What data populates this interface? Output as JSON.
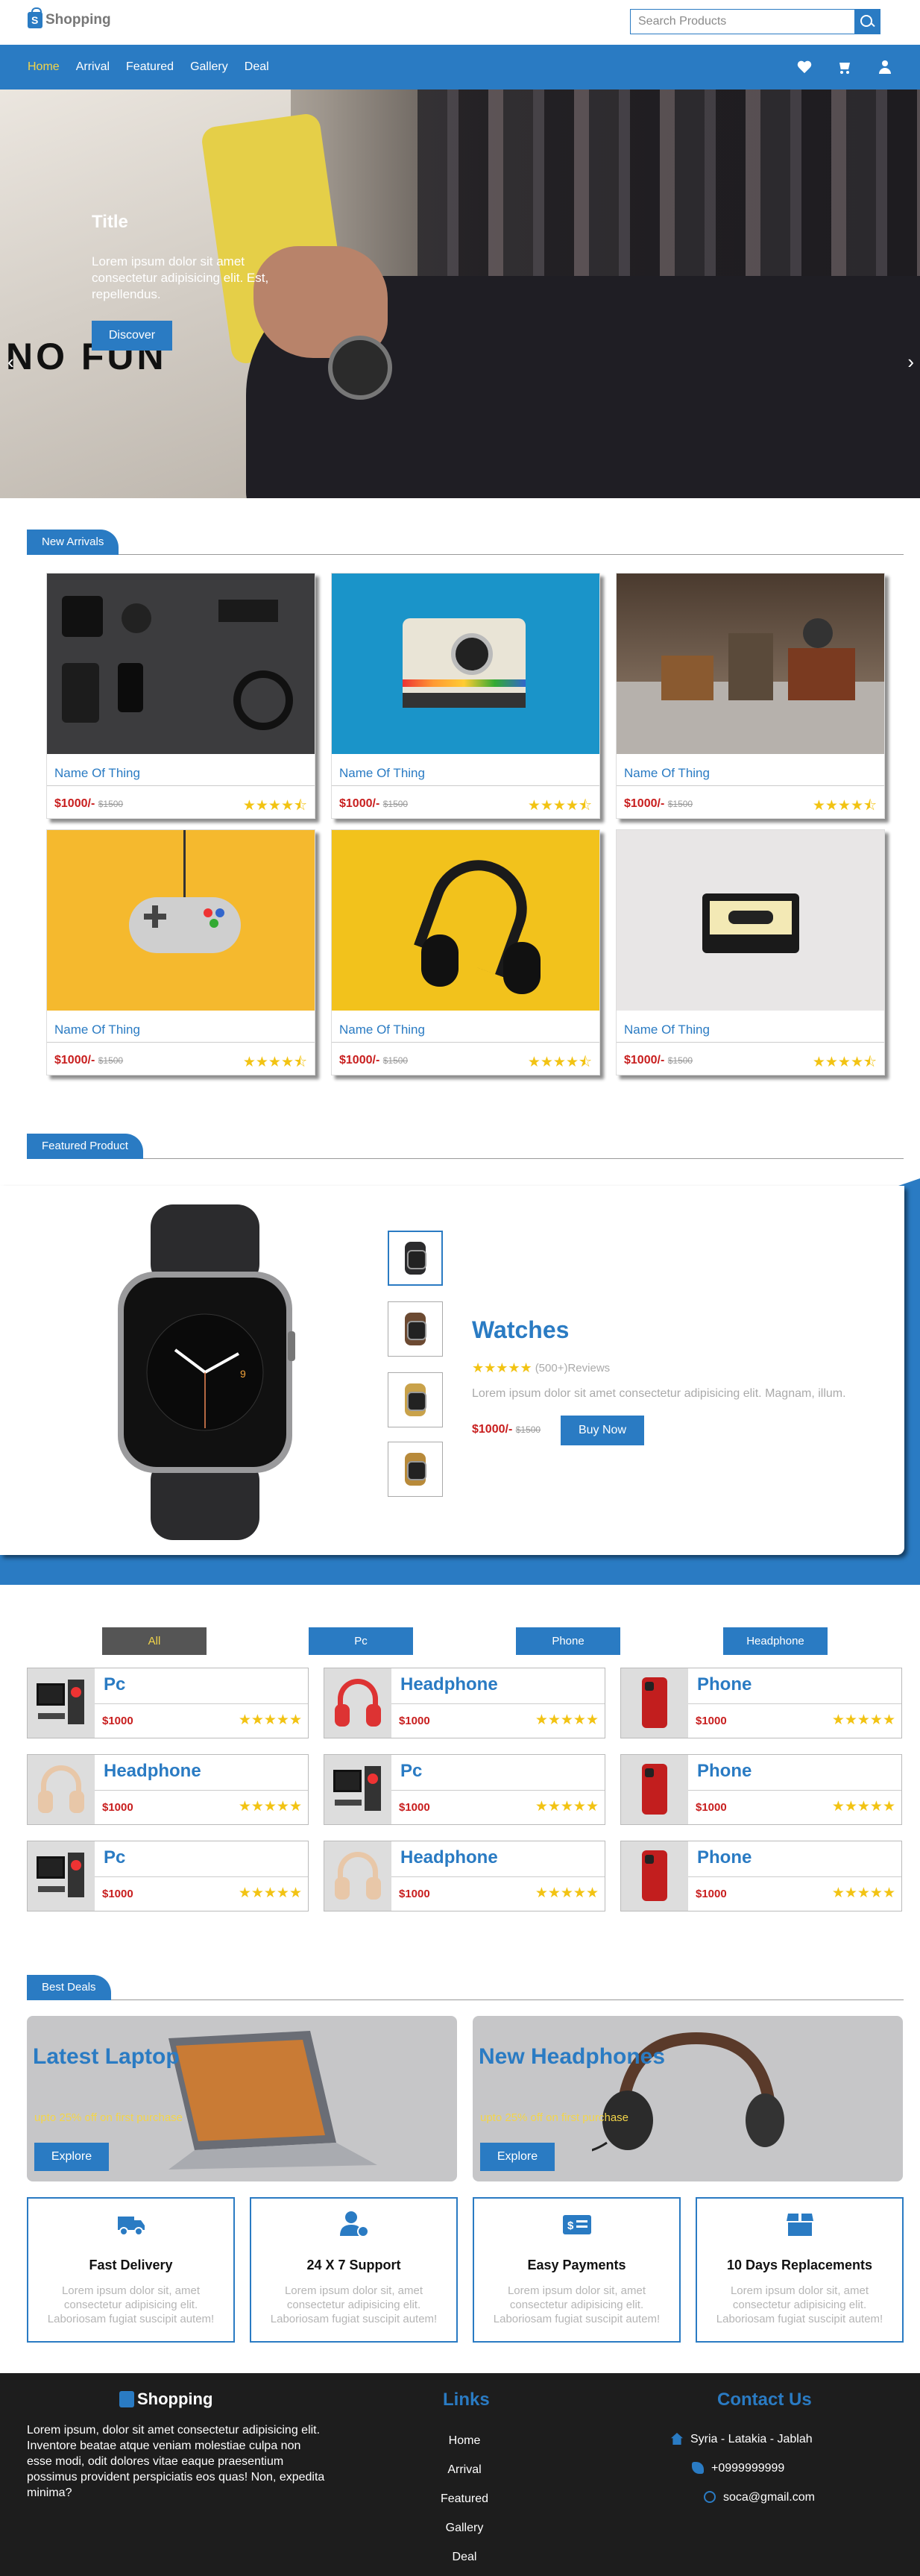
{
  "brand": "Shopping",
  "search": {
    "placeholder": "Search Products"
  },
  "nav": {
    "links": [
      "Home",
      "Arrival",
      "Featured",
      "Gallery",
      "Deal"
    ],
    "active": "Home",
    "icons": [
      "heart-icon",
      "cart-icon",
      "user-icon"
    ]
  },
  "hero": {
    "title": "Title",
    "text": "Lorem ipsum dolor sit amet consectetur adipisicing elit. Est, repellendus.",
    "button": "Discover",
    "photo_text": "NO FUN",
    "prev": "‹",
    "next": "›"
  },
  "new_arrivals": {
    "heading": "New Arrivals",
    "products": [
      {
        "name": "Name Of Thing",
        "price": "$1000/-",
        "old_price": "$1500",
        "rating": 4.5,
        "image": "flat-lay-accessories"
      },
      {
        "name": "Name Of Thing",
        "price": "$1000/-",
        "old_price": "$1500",
        "rating": 4.5,
        "image": "polaroid-camera"
      },
      {
        "name": "Name Of Thing",
        "price": "$1000/-",
        "old_price": "$1500",
        "rating": 4.5,
        "image": "vintage-cameras"
      },
      {
        "name": "Name Of Thing",
        "price": "$1000/-",
        "old_price": "$1500",
        "rating": 4.5,
        "image": "game-controller"
      },
      {
        "name": "Name Of Thing",
        "price": "$1000/-",
        "old_price": "$1500",
        "rating": 4.5,
        "image": "headphones"
      },
      {
        "name": "Name Of Thing",
        "price": "$1000/-",
        "old_price": "$1500",
        "rating": 4.5,
        "image": "cassette-tape"
      }
    ]
  },
  "featured": {
    "heading": "Featured Product",
    "title": "Watches",
    "reviews": "(500+)Reviews",
    "rating": 5,
    "description": "Lorem ipsum dolor sit amet consectetur adipisicing elit. Magnam, illum.",
    "price": "$1000/-",
    "old_price": "$1500",
    "button": "Buy Now",
    "thumbnails": [
      "black-watch",
      "brown-watch",
      "gold-watch",
      "gold-watch-2"
    ],
    "selected_thumbnail": 0
  },
  "categories": {
    "filters": [
      "All",
      "Pc",
      "Phone",
      "Headphone"
    ],
    "active_filter": "All",
    "items": [
      {
        "title": "Pc",
        "price": "$1000",
        "rating": 5,
        "image": "pc-icon"
      },
      {
        "title": "Headphone",
        "price": "$1000",
        "rating": 5,
        "image": "headphone-icon"
      },
      {
        "title": "Phone",
        "price": "$1000",
        "rating": 5,
        "image": "phone-icon"
      },
      {
        "title": "Headphone",
        "price": "$1000",
        "rating": 5,
        "image": "headphone-icon"
      },
      {
        "title": "Pc",
        "price": "$1000",
        "rating": 5,
        "image": "pc-icon"
      },
      {
        "title": "Phone",
        "price": "$1000",
        "rating": 5,
        "image": "phone-icon"
      },
      {
        "title": "Pc",
        "price": "$1000",
        "rating": 5,
        "image": "pc-icon"
      },
      {
        "title": "Headphone",
        "price": "$1000",
        "rating": 5,
        "image": "headphone-icon"
      },
      {
        "title": "Phone",
        "price": "$1000",
        "rating": 5,
        "image": "phone-icon"
      }
    ]
  },
  "best_deals": {
    "heading": "Best Deals",
    "deals": [
      {
        "title": "Latest Laptop",
        "offer": "upto 25% off on first purchase",
        "button": "Explore",
        "image": "laptop"
      },
      {
        "title": "New Headphones",
        "offer": "upto 25% off on first purchase",
        "button": "Explore",
        "image": "headphones"
      }
    ]
  },
  "features": [
    {
      "title": "Fast Delivery",
      "text": "Lorem ipsum dolor sit, amet consectetur adipisicing elit. Laboriosam fugiat suscipit autem!",
      "icon": "truck-icon"
    },
    {
      "title": "24 X 7 Support",
      "text": "Lorem ipsum dolor sit, amet consectetur adipisicing elit. Laboriosam fugiat suscipit autem!",
      "icon": "support-user-icon"
    },
    {
      "title": "Easy Payments",
      "text": "Lorem ipsum dolor sit, amet consectetur adipisicing elit. Laboriosam fugiat suscipit autem!",
      "icon": "money-bill-icon"
    },
    {
      "title": "10 Days Replacements",
      "text": "Lorem ipsum dolor sit, amet consectetur adipisicing elit. Laboriosam fugiat suscipit autem!",
      "icon": "box-icon"
    }
  ],
  "footer": {
    "brand": "Shopping",
    "about": "Lorem ipsum, dolor sit amet consectetur adipisicing elit. Inventore beatae atque veniam molestiae culpa non esse modi, odit dolores vitae eaque praesentium possimus provident perspiciatis eos quas! Non, expedita minima?",
    "links_heading": "Links",
    "links": [
      "Home",
      "Arrival",
      "Featured",
      "Gallery",
      "Deal"
    ],
    "contact_heading": "Contact Us",
    "contact": [
      {
        "icon": "home-icon",
        "text": "Syria - Latakia - Jablah"
      },
      {
        "icon": "phone-icon",
        "text": "+0999999999"
      },
      {
        "icon": "globe-icon",
        "text": "soca@gmail.com"
      }
    ]
  },
  "colors": {
    "primary": "#2a7bc3",
    "accent": "#f3d54a",
    "price": "#c81e1e",
    "footer": "#1d1d1d",
    "star": "#f2c313"
  }
}
